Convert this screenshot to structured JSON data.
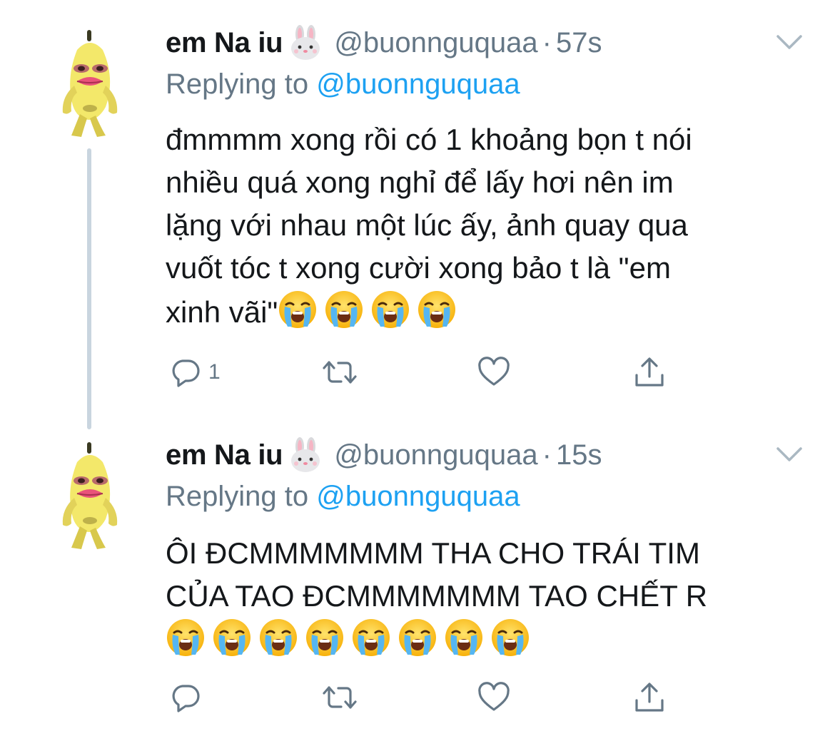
{
  "tweets": [
    {
      "display_name": "em Na iu",
      "name_emoji": "rabbit-face",
      "handle": "@buonnguquaa",
      "separator": "·",
      "time": "57s",
      "replying_prefix": "Replying to",
      "replying_to": "@buonnguquaa",
      "body_lines": [
        "đmmmm xong rồi có 1 khoảng bọn t nói",
        "nhiều quá xong nghỉ để lấy hơi nên im",
        "lặng với nhau một lúc ấy, ảnh quay qua",
        "vuốt tóc t xong cười xong bảo t là \"em",
        "xinh vãi\""
      ],
      "emoji_name": "loudly-crying-face",
      "emoji_count": 4,
      "reply_count": "1"
    },
    {
      "display_name": "em Na iu",
      "name_emoji": "rabbit-face",
      "handle": "@buonnguquaa",
      "separator": "·",
      "time": "15s",
      "replying_prefix": "Replying to",
      "replying_to": "@buonnguquaa",
      "body_lines": [
        "ÔI ĐCMMMMMMM THA CHO TRÁI TIM",
        "CỦA TAO ĐCMMMMMMM TAO CHẾT R"
      ],
      "emoji_name": "loudly-crying-face",
      "emoji_count": 8,
      "reply_count": ""
    }
  ],
  "colors": {
    "text": "#14171a",
    "secondary": "#657786",
    "link": "#1da1f2",
    "thread_line": "#c9d5df",
    "icon": "#657786"
  },
  "icons": {
    "reply": "reply-icon",
    "retweet": "retweet-icon",
    "like": "heart-icon",
    "share": "share-icon",
    "more": "chevron-down-icon"
  }
}
